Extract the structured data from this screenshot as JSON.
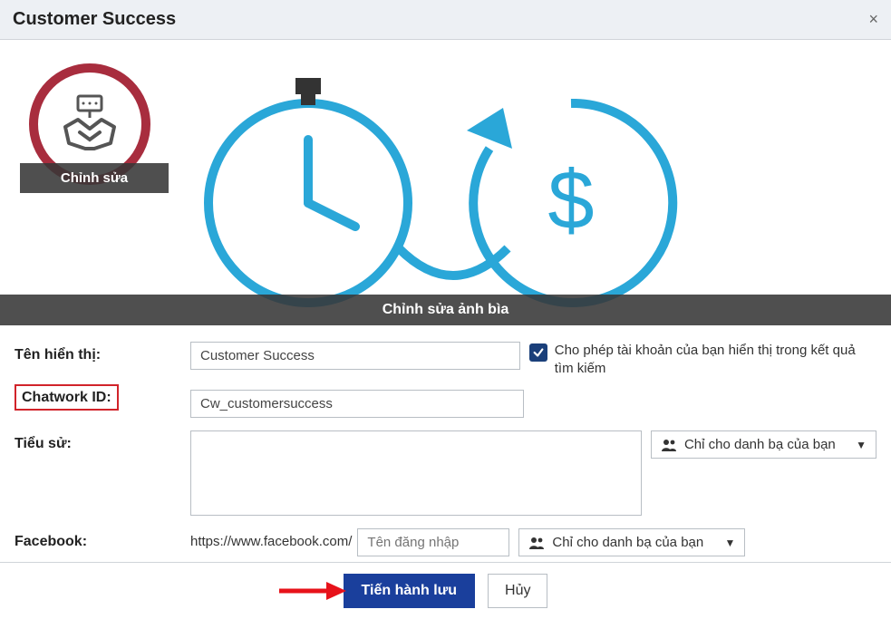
{
  "header": {
    "title": "Customer Success"
  },
  "avatar": {
    "edit_label": "Chỉnh sửa"
  },
  "cover": {
    "edit_label": "Chỉnh sửa ảnh bìa"
  },
  "fields": {
    "display_name": {
      "label": "Tên hiển thị:",
      "value": "Customer Success"
    },
    "search_visible": {
      "label": "Cho phép tài khoản của bạn hiển thị trong kết quả tìm kiếm"
    },
    "chatwork_id": {
      "label": "Chatwork ID:",
      "value": "Cw_customersuccess"
    },
    "bio": {
      "label": "Tiểu sử:"
    },
    "privacy_option": "Chỉ cho danh bạ của bạn",
    "facebook": {
      "label": "Facebook:",
      "prefix": "https://www.facebook.com/",
      "placeholder": "Tên đăng nhập"
    }
  },
  "actions": {
    "save": "Tiến hành lưu",
    "cancel": "Hủy"
  }
}
